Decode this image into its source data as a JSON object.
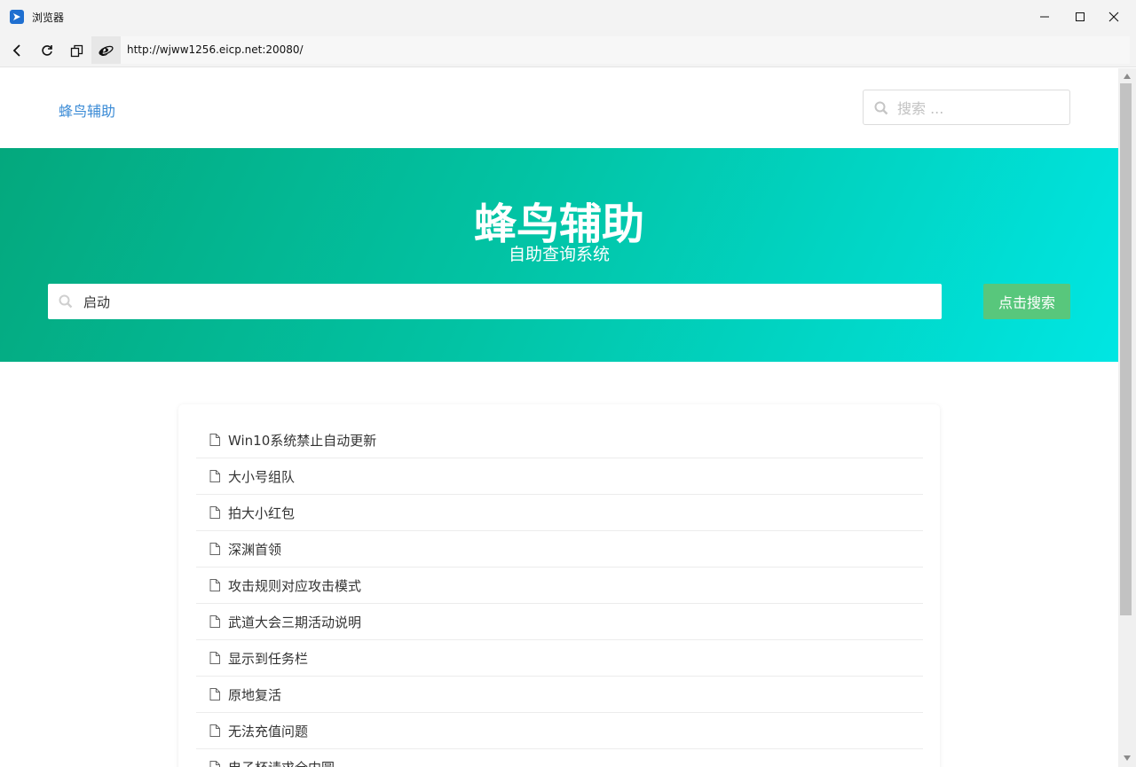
{
  "window": {
    "title": "浏览器"
  },
  "navbar": {
    "url": "http://wjww1256.eicp.net:20080/"
  },
  "header": {
    "brand": "蜂鸟辅助",
    "search_placeholder": "搜索 ..."
  },
  "hero": {
    "title": "蜂鸟辅助",
    "subtitle": "自助查询系统",
    "search_value": "启动",
    "button_label": "点击搜索"
  },
  "results": [
    {
      "title": "Win10系统禁止自动更新"
    },
    {
      "title": "大小号组队"
    },
    {
      "title": "拍大小红包"
    },
    {
      "title": "深渊首领"
    },
    {
      "title": "攻击规则对应攻击模式"
    },
    {
      "title": "武道大会三期活动说明"
    },
    {
      "title": "显示到任务栏"
    },
    {
      "title": "原地复活"
    },
    {
      "title": "无法充值问题"
    },
    {
      "title": "电子杯请求全内圆"
    }
  ],
  "colors": {
    "hero_gradient_start": "#04a87d",
    "hero_gradient_end": "#00e6e3",
    "search_button": "#58c77c",
    "brand_link": "#3b8bd6"
  }
}
